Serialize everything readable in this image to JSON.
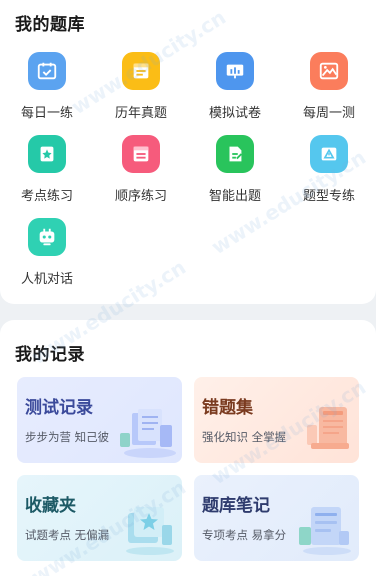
{
  "question_bank": {
    "title": "我的题库",
    "tiles": [
      {
        "label": "每日一练",
        "icon": "calendar-check-icon",
        "color": "#5ba3f0"
      },
      {
        "label": "历年真题",
        "icon": "document-list-icon",
        "color": "#fbbd16"
      },
      {
        "label": "模拟试卷",
        "icon": "bar-chart-board-icon",
        "color": "#4e96ee"
      },
      {
        "label": "每周一测",
        "icon": "picture-frame-icon",
        "color": "#fb7d5c"
      },
      {
        "label": "考点练习",
        "icon": "star-badge-icon",
        "color": "#25c9a8"
      },
      {
        "label": "顺序练习",
        "icon": "numbered-list-icon",
        "color": "#f65b7c"
      },
      {
        "label": "智能出题",
        "icon": "edit-document-icon",
        "color": "#29c45c"
      },
      {
        "label": "题型专练",
        "icon": "triangle-warning-icon",
        "color": "#55c7ee"
      },
      {
        "label": "人机对话",
        "icon": "robot-icon",
        "color": "#2fd1b3"
      }
    ]
  },
  "records": {
    "title": "我的记录",
    "cards": [
      {
        "title": "测试记录",
        "subtitle": "步步为营 知己彼",
        "title_color": "#3b4a9b",
        "bg_from": "#e7ecfe",
        "bg_to": "#dfe7fe",
        "art": "test-record-illustration"
      },
      {
        "title": "错题集",
        "subtitle": "强化知识 全掌握",
        "title_color": "#7a3a1f",
        "bg_from": "#fff0e9",
        "bg_to": "#ffe3d8",
        "art": "wrong-questions-illustration"
      },
      {
        "title": "收藏夹",
        "subtitle": "试题考点 无偏漏",
        "title_color": "#1d5a66",
        "bg_from": "#e6f5fb",
        "bg_to": "#dbf1f8",
        "art": "favorites-illustration"
      },
      {
        "title": "题库笔记",
        "subtitle": "专项考点 易拿分",
        "title_color": "#2f3c6e",
        "bg_from": "#eaf1fc",
        "bg_to": "#e1ebfb",
        "art": "notes-illustration"
      }
    ]
  }
}
